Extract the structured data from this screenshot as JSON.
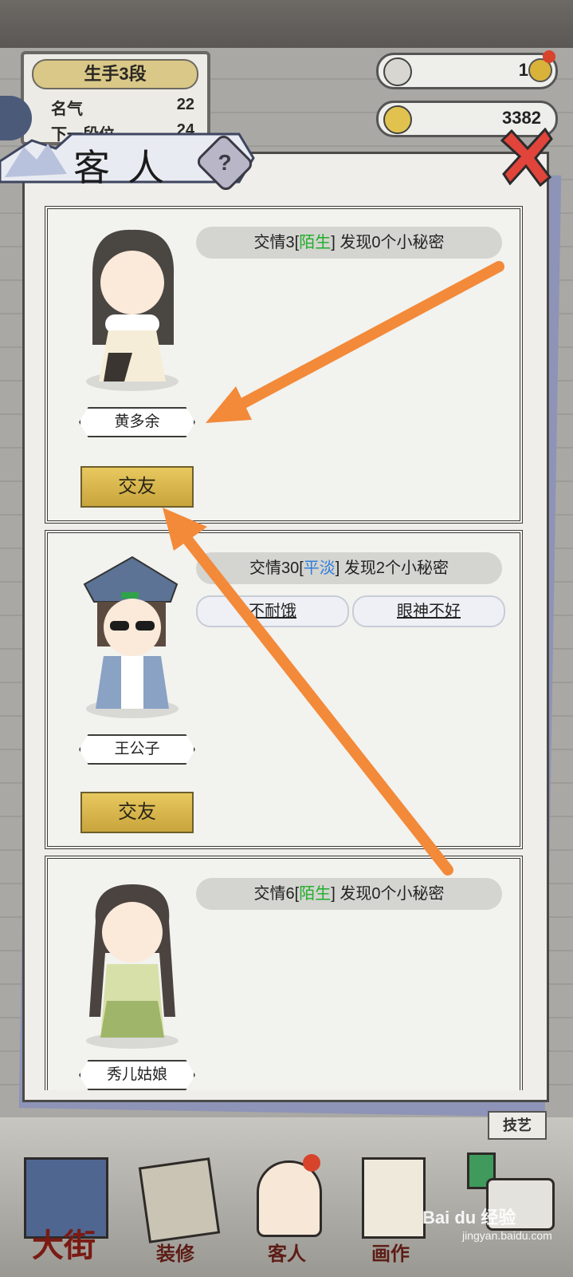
{
  "rank": {
    "title": "生手3段",
    "fame_label": "名气",
    "fame_value": "22",
    "next_label": "下一段位",
    "next_value": "24"
  },
  "currency": {
    "scroll_count": "1",
    "coins": "3382"
  },
  "panel": {
    "title": "客人",
    "help": "?"
  },
  "guests": [
    {
      "name": "黄多余",
      "rel_prefix": "交情3[",
      "rel_status": "陌生",
      "rel_suffix": "] 发现0个小秘密",
      "button": "交友"
    },
    {
      "name": "王公子",
      "rel_prefix": "交情30[",
      "rel_status": "平淡",
      "rel_suffix": "] 发现2个小秘密",
      "secrets": [
        "不耐饿",
        "眼神不好"
      ],
      "button": "交友"
    },
    {
      "name": "秀儿姑娘",
      "rel_prefix": "交情6[",
      "rel_status": "陌生",
      "rel_suffix": "] 发现0个小秘密"
    }
  ],
  "nav": {
    "street": "大街",
    "decor": "装修",
    "guests": "客人",
    "painting": "画作",
    "skills": "技艺"
  },
  "watermark": {
    "brand": "Bai du 经验",
    "url": "jingyan.baidu.com"
  },
  "colors": {
    "status_green": "#1fae2a",
    "status_blue": "#2f7fdc",
    "arrow": "#f28a3a",
    "button_gold": "#d8b84c"
  }
}
